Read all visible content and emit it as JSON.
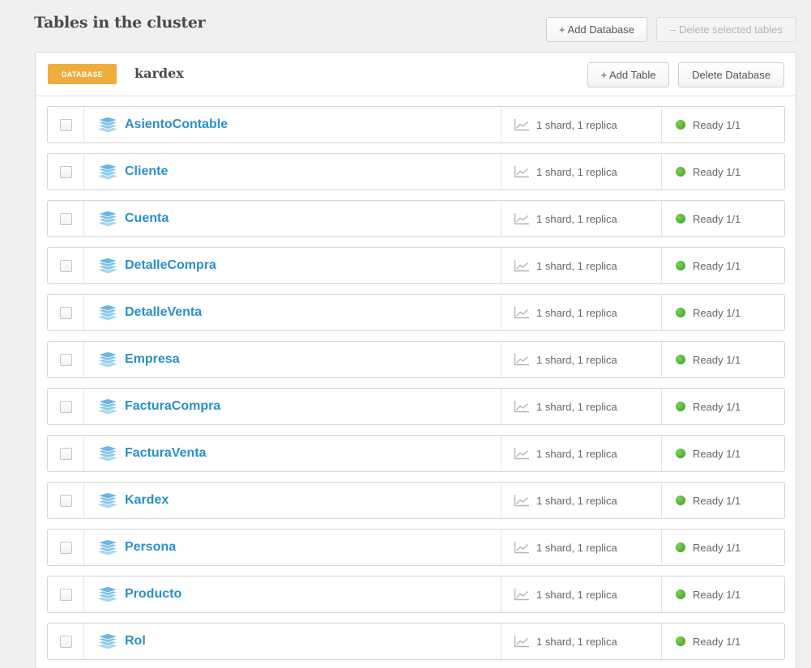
{
  "header": {
    "title": "Tables in the cluster",
    "add_database_label": "+ Add Database",
    "delete_selected_label": "– Delete selected tables"
  },
  "database": {
    "badge_label": "DATABASE",
    "name": "kardex",
    "add_table_label": "+ Add Table",
    "delete_database_label": "Delete Database"
  },
  "colors": {
    "accent_link": "#2b8fc9",
    "badge": "#f0ad3c",
    "status_ready": "#4caf2a",
    "table_icon": "#7fc1e6"
  },
  "icons": {
    "table": "stacked-layers-icon",
    "shards": "line-chart-icon",
    "status": "green-dot-icon"
  },
  "tables": [
    {
      "name": "AsientoContable",
      "shards": "1 shard, 1 replica",
      "status": "Ready 1/1"
    },
    {
      "name": "Cliente",
      "shards": "1 shard, 1 replica",
      "status": "Ready 1/1"
    },
    {
      "name": "Cuenta",
      "shards": "1 shard, 1 replica",
      "status": "Ready 1/1"
    },
    {
      "name": "DetalleCompra",
      "shards": "1 shard, 1 replica",
      "status": "Ready 1/1"
    },
    {
      "name": "DetalleVenta",
      "shards": "1 shard, 1 replica",
      "status": "Ready 1/1"
    },
    {
      "name": "Empresa",
      "shards": "1 shard, 1 replica",
      "status": "Ready 1/1"
    },
    {
      "name": "FacturaCompra",
      "shards": "1 shard, 1 replica",
      "status": "Ready 1/1"
    },
    {
      "name": "FacturaVenta",
      "shards": "1 shard, 1 replica",
      "status": "Ready 1/1"
    },
    {
      "name": "Kardex",
      "shards": "1 shard, 1 replica",
      "status": "Ready 1/1"
    },
    {
      "name": "Persona",
      "shards": "1 shard, 1 replica",
      "status": "Ready 1/1"
    },
    {
      "name": "Producto",
      "shards": "1 shard, 1 replica",
      "status": "Ready 1/1"
    },
    {
      "name": "Rol",
      "shards": "1 shard, 1 replica",
      "status": "Ready 1/1"
    }
  ]
}
